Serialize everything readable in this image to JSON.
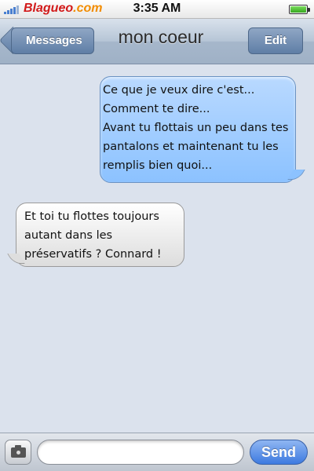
{
  "status_bar": {
    "carrier_name": "Blagueo",
    "carrier_tld": ".com",
    "time": "3:35 AM",
    "battery_level": 1.0,
    "signal_bars": 4
  },
  "nav": {
    "back_label": "Messages",
    "title": "mon coeur",
    "edit_label": "Edit"
  },
  "messages": [
    {
      "direction": "sent",
      "text": "Ce que je veux dire c'est...\nComment te dire...\nAvant tu flottais un peu dans tes pantalons et maintenant tu les remplis bien quoi..."
    },
    {
      "direction": "received",
      "text": "Et toi tu flottes toujours autant dans les préservatifs ? Connard !"
    }
  ],
  "input_bar": {
    "message_value": "",
    "send_label": "Send"
  },
  "colors": {
    "sent_bubble": "#8cc2ff",
    "received_bubble": "#dddddd",
    "send_button": "#3d7ae0",
    "carrier_red": "#d21a1a",
    "carrier_orange": "#f28c00"
  },
  "icons": {
    "signal": "signal-bars-icon",
    "battery": "battery-icon",
    "camera": "camera-icon"
  }
}
